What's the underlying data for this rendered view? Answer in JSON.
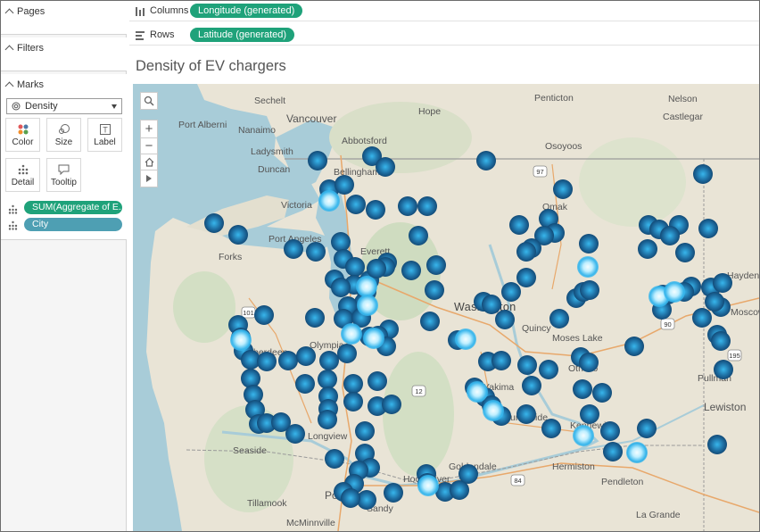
{
  "left_panel": {
    "pages_title": "Pages",
    "filters_title": "Filters",
    "marks_title": "Marks",
    "mark_type": "Density",
    "buttons": {
      "color": "Color",
      "size": "Size",
      "label": "Label",
      "detail": "Detail",
      "tooltip": "Tooltip"
    },
    "fields": [
      "SUM(Aggregate of E...",
      "City"
    ]
  },
  "shelves": {
    "columns_label": "Columns",
    "columns_field": "Longitude (generated)",
    "rows_label": "Rows",
    "rows_field": "Latitude (generated)"
  },
  "sheet": {
    "title": "Density of EV chargers"
  },
  "map": {
    "place_labels": [
      "Sechelt",
      "Penticton",
      "Nelson",
      "Vancouver",
      "Hope",
      "Castlegar",
      "Nanaimo",
      "Abbotsford",
      "Port Alberni",
      "Osoyoos",
      "Ladysmith",
      "Duncan",
      "Bellingham",
      "Omak",
      "Victoria",
      "Port Angeles",
      "Forks",
      "Everett",
      "Washington",
      "Quincy",
      "Moses Lake",
      "Olympia",
      "Aberdeen",
      "Othello",
      "Yakima",
      "Pullman",
      "Longview",
      "Kennewick",
      "Lewiston",
      "Sunnyside",
      "Seaside",
      "Goldendale",
      "Hermiston",
      "Pendleton",
      "Tillamook",
      "Portland",
      "Hood River",
      "Sandy",
      "McMinnville",
      "La Grande",
      "Hayden",
      "Moscow"
    ],
    "highway_shields": [
      "97",
      "101",
      "90",
      "12",
      "195",
      "84"
    ],
    "controls": [
      "search-icon",
      "zoom-in-icon",
      "zoom-out-icon",
      "home-icon",
      "play-icon"
    ]
  },
  "colors": {
    "density_core": "#f4fdff",
    "density_mid": "#38b6ec",
    "density_edge": "#0e3e68",
    "pill_green": "#1fa27a",
    "pill_blue": "#4e9fb3"
  }
}
